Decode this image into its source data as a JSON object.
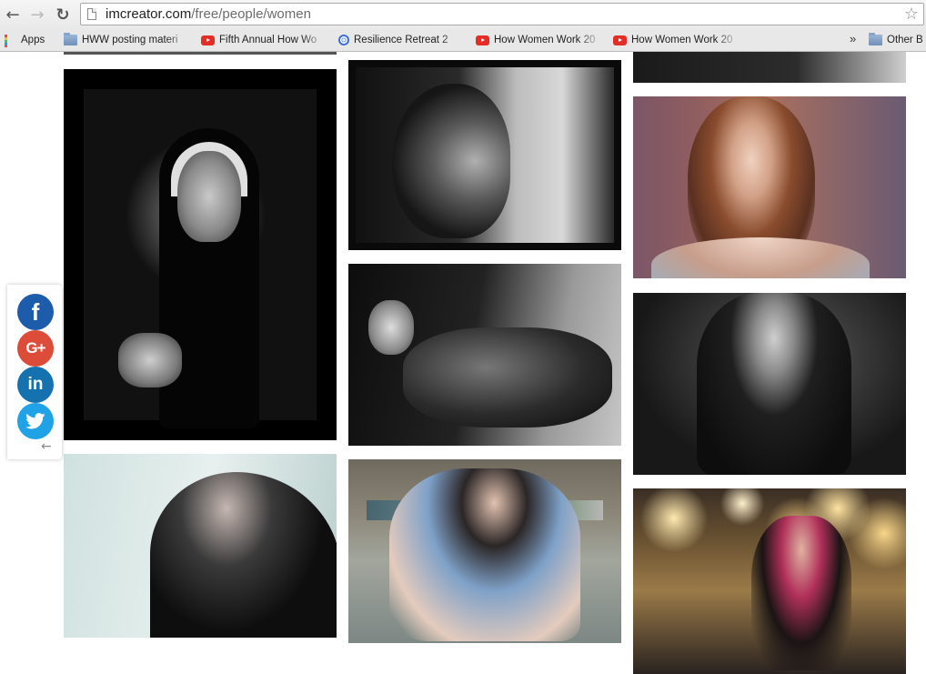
{
  "browser": {
    "url_host": "imcreator.com",
    "url_path": "/free/people/women",
    "back_icon": "←",
    "forward_icon": "→",
    "reload_icon": "↻",
    "star_icon": "☆"
  },
  "bookmarks": {
    "items": [
      {
        "label": "Apps",
        "icon": "apps-grid-icon"
      },
      {
        "label": "HWW posting materi",
        "icon": "folder-icon"
      },
      {
        "label": "Fifth Annual How Wo",
        "icon": "youtube-icon"
      },
      {
        "label": "Resilience Retreat 2",
        "icon": "globe-icon"
      },
      {
        "label": "How Women Work 20",
        "icon": "youtube-icon"
      },
      {
        "label": "How Women Work 20",
        "icon": "youtube-icon"
      }
    ],
    "overflow_label": "»",
    "other": {
      "label": "Other B",
      "icon": "folder-icon"
    }
  },
  "share": {
    "facebook": "f",
    "google": "G+",
    "linkedin": "in",
    "collapse": "←"
  },
  "colors": {
    "facebook": "#1d5cab",
    "google": "#dd4b39",
    "linkedin": "#1672ae",
    "twitter": "#1fa2e6"
  }
}
